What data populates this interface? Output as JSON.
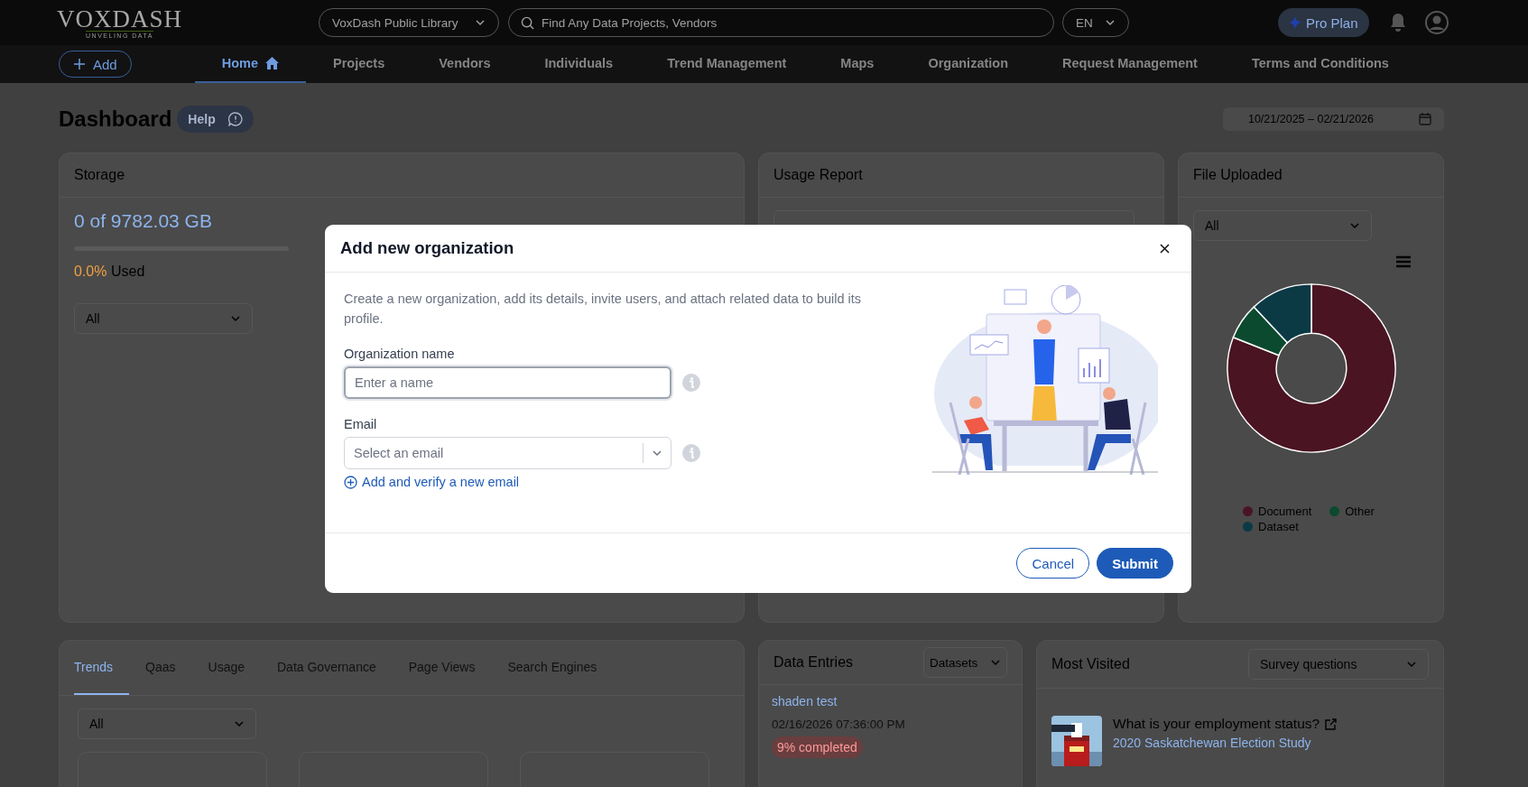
{
  "header": {
    "logo": {
      "name": "VOXDASH",
      "tagline": "UNVELING DATA"
    },
    "library_select": "VoxDash Public Library",
    "search": {
      "placeholder": "Find Any Data Projects, Vendors"
    },
    "language": "EN",
    "plan_button": "Pro Plan"
  },
  "nav": {
    "add_button": "Add",
    "items": [
      {
        "label": "Home",
        "selected": true
      },
      {
        "label": "Projects",
        "selected": false
      },
      {
        "label": "Vendors",
        "selected": false
      },
      {
        "label": "Individuals",
        "selected": false
      },
      {
        "label": "Trend Management",
        "selected": false
      },
      {
        "label": "Maps",
        "selected": false
      },
      {
        "label": "Organization",
        "selected": false
      },
      {
        "label": "Request Management",
        "selected": false
      },
      {
        "label": "Terms and Conditions",
        "selected": false
      }
    ]
  },
  "page": {
    "title": "Dashboard",
    "help_button": "Help",
    "date_range": "10/21/2025 – 02/21/2026"
  },
  "storage": {
    "title": "Storage",
    "total": "0 of 9782.03 GB",
    "level": 0,
    "percent": "0.0%",
    "used_label": "Used",
    "filter": "All"
  },
  "usage_report": {
    "title": "Usage Report"
  },
  "file_uploaded": {
    "title": "File Uploaded",
    "filter": "All",
    "legend": [
      {
        "label": "Document",
        "color": "#4a1422"
      },
      {
        "label": "Other",
        "color": "#0b4a2e"
      },
      {
        "label": "Dataset",
        "color": "#0b3a45"
      }
    ]
  },
  "trends": {
    "tabs": [
      {
        "label": "Trends",
        "selected": true
      },
      {
        "label": "Qaas",
        "selected": false
      },
      {
        "label": "Usage",
        "selected": false
      },
      {
        "label": "Data Governance",
        "selected": false
      },
      {
        "label": "Page Views",
        "selected": false
      },
      {
        "label": "Search Engines",
        "selected": false
      }
    ],
    "filter": "All"
  },
  "data_entries": {
    "title": "Data Entries",
    "filter": "Datasets",
    "entries": [
      {
        "name": "shaden test",
        "date": "02/16/2026 07:36:00 PM",
        "status": "9% completed"
      }
    ]
  },
  "most_visited": {
    "title": "Most Visited",
    "filter": "Survey questions",
    "items": [
      {
        "kind": "picture",
        "question": "What is your employment status?",
        "study": "2020 Saskatchewan Election Study"
      }
    ]
  },
  "modal": {
    "title": "Add new organization",
    "description": "Create a new organization, add its details, invite users, and attach related data to build its profile.",
    "fields": [
      {
        "kind": "text",
        "label": "Organization name",
        "placeholder": "Enter a name"
      },
      {
        "kind": "select",
        "label": "Email",
        "placeholder": "Select an email"
      }
    ],
    "add_email_link": "Add and verify a new email",
    "buttons": [
      {
        "label": "Cancel",
        "kind": "secondary"
      },
      {
        "label": "Submit",
        "kind": "primary"
      }
    ]
  }
}
